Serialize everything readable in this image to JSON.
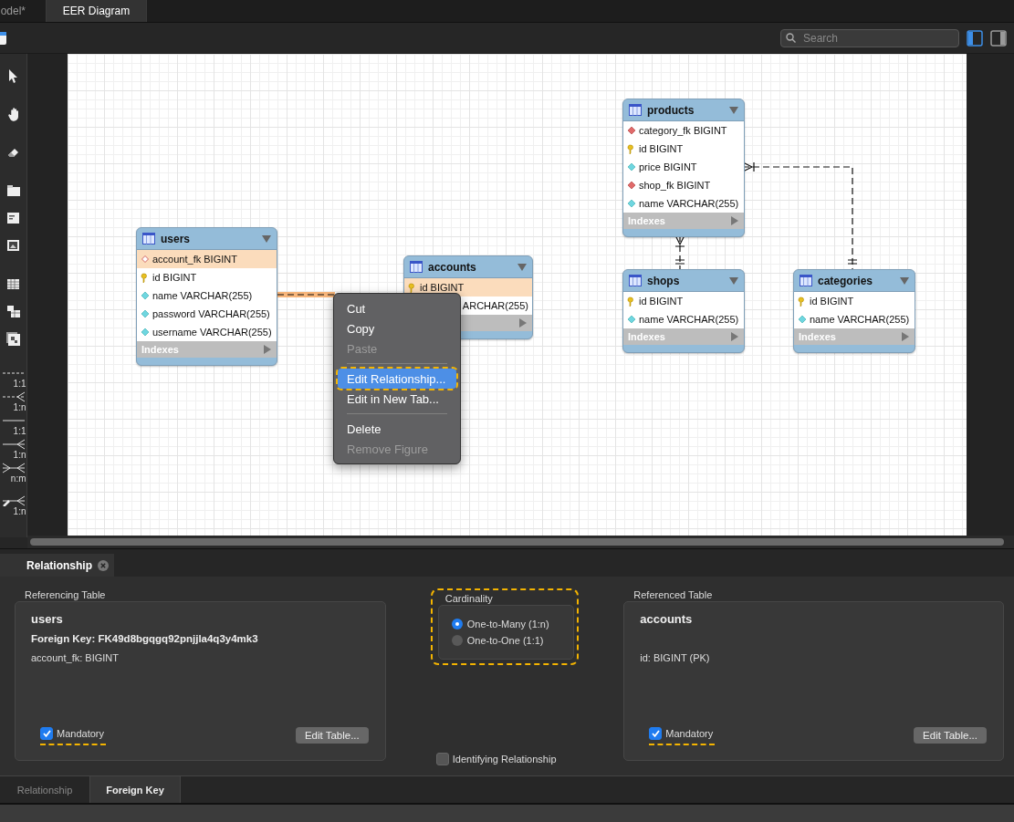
{
  "document_tabs": [
    {
      "label": "odel*",
      "selected": false
    },
    {
      "label": "EER Diagram",
      "selected": true
    }
  ],
  "toolbar": {
    "search": {
      "placeholder": "Search"
    },
    "sidebar_toggles": [
      {
        "on": true
      },
      {
        "on": false
      }
    ]
  },
  "relationship_tools": [
    {
      "kind": "dashed-one",
      "label": "1:1"
    },
    {
      "kind": "dashed-many",
      "label": "1:n"
    },
    {
      "kind": "solid-one",
      "label": "1:1"
    },
    {
      "kind": "solid-many",
      "label": "1:n"
    },
    {
      "kind": "many-many",
      "label": "n:m"
    },
    {
      "kind": "pick-many",
      "label": "1:n"
    }
  ],
  "diagram": {
    "tables": [
      {
        "name": "users",
        "indexes_label": "Indexes",
        "columns": [
          {
            "text": "account_fk BIGINT",
            "kind": "fk-open",
            "highlighted": true
          },
          {
            "text": "id BIGINT",
            "kind": "pk",
            "highlighted": false
          },
          {
            "text": "name VARCHAR(255)",
            "kind": "column",
            "highlighted": false
          },
          {
            "text": "password VARCHAR(255)",
            "kind": "column",
            "highlighted": false
          },
          {
            "text": "username VARCHAR(255)",
            "kind": "column",
            "highlighted": false
          }
        ]
      },
      {
        "name": "accounts",
        "columns": [
          {
            "text": "id BIGINT",
            "kind": "pk",
            "highlighted": true
          },
          {
            "text": "ARCHAR(255)",
            "kind": "covered",
            "highlighted": false
          }
        ]
      },
      {
        "name": "products",
        "indexes_label": "Indexes",
        "columns": [
          {
            "text": "category_fk BIGINT",
            "kind": "fk",
            "highlighted": false
          },
          {
            "text": "id BIGINT",
            "kind": "pk",
            "highlighted": false
          },
          {
            "text": "price BIGINT",
            "kind": "column",
            "highlighted": false
          },
          {
            "text": "shop_fk BIGINT",
            "kind": "fk",
            "highlighted": false
          },
          {
            "text": "name VARCHAR(255)",
            "kind": "column",
            "highlighted": false
          }
        ]
      },
      {
        "name": "shops",
        "indexes_label": "Indexes",
        "columns": [
          {
            "text": "id BIGINT",
            "kind": "pk",
            "highlighted": false
          },
          {
            "text": "name VARCHAR(255)",
            "kind": "column",
            "highlighted": false
          }
        ]
      },
      {
        "name": "categories",
        "indexes_label": "Indexes",
        "columns": [
          {
            "text": "id BIGINT",
            "kind": "pk",
            "highlighted": false
          },
          {
            "text": "name VARCHAR(255)",
            "kind": "column",
            "highlighted": false
          }
        ]
      }
    ],
    "relationships": [
      {
        "selected": true
      },
      {
        "selected": false
      },
      {
        "selected": false
      }
    ],
    "context_menu": [
      {
        "kind": "item",
        "label": "Cut",
        "disabled": false,
        "selected": false,
        "annotated": false
      },
      {
        "kind": "item",
        "label": "Copy",
        "disabled": false,
        "selected": false,
        "annotated": false
      },
      {
        "kind": "item",
        "label": "Paste",
        "disabled": true,
        "selected": false,
        "annotated": false
      },
      {
        "kind": "separator"
      },
      {
        "kind": "item",
        "label": "Edit Relationship...",
        "disabled": false,
        "selected": true,
        "annotated": true
      },
      {
        "kind": "item",
        "label": "Edit in New Tab...",
        "disabled": false,
        "selected": false,
        "annotated": false
      },
      {
        "kind": "separator"
      },
      {
        "kind": "item",
        "label": "Delete",
        "disabled": false,
        "selected": false,
        "annotated": false
      },
      {
        "kind": "item",
        "label": "Remove Figure",
        "disabled": true,
        "selected": false,
        "annotated": false
      }
    ]
  },
  "editor": {
    "tab": {
      "label": "Relationship",
      "selected": true
    },
    "referencing": {
      "heading": "Referencing Table",
      "table": "users",
      "foreign_key": "Foreign Key: FK49d8bgqgq92pnjjla4q3y4mk3",
      "column": "account_fk: BIGINT",
      "mandatory": {
        "label": "Mandatory",
        "checked": true,
        "annotated": true
      },
      "button": "Edit Table..."
    },
    "cardinality": {
      "heading": "Cardinality",
      "annotated": true,
      "options": [
        {
          "label": "One-to-Many (1:n)",
          "selected": true
        },
        {
          "label": "One-to-One (1:1)",
          "selected": false
        }
      ]
    },
    "identifying": {
      "label": "Identifying Relationship",
      "checked": false
    },
    "referenced": {
      "heading": "Referenced Table",
      "table": "accounts",
      "column": "id: BIGINT (PK)",
      "mandatory": {
        "label": "Mandatory",
        "checked": true,
        "annotated": true
      },
      "button": "Edit Table..."
    },
    "bottom_tabs": [
      {
        "label": "Relationship",
        "selected": false
      },
      {
        "label": "Foreign Key",
        "selected": true
      }
    ]
  }
}
